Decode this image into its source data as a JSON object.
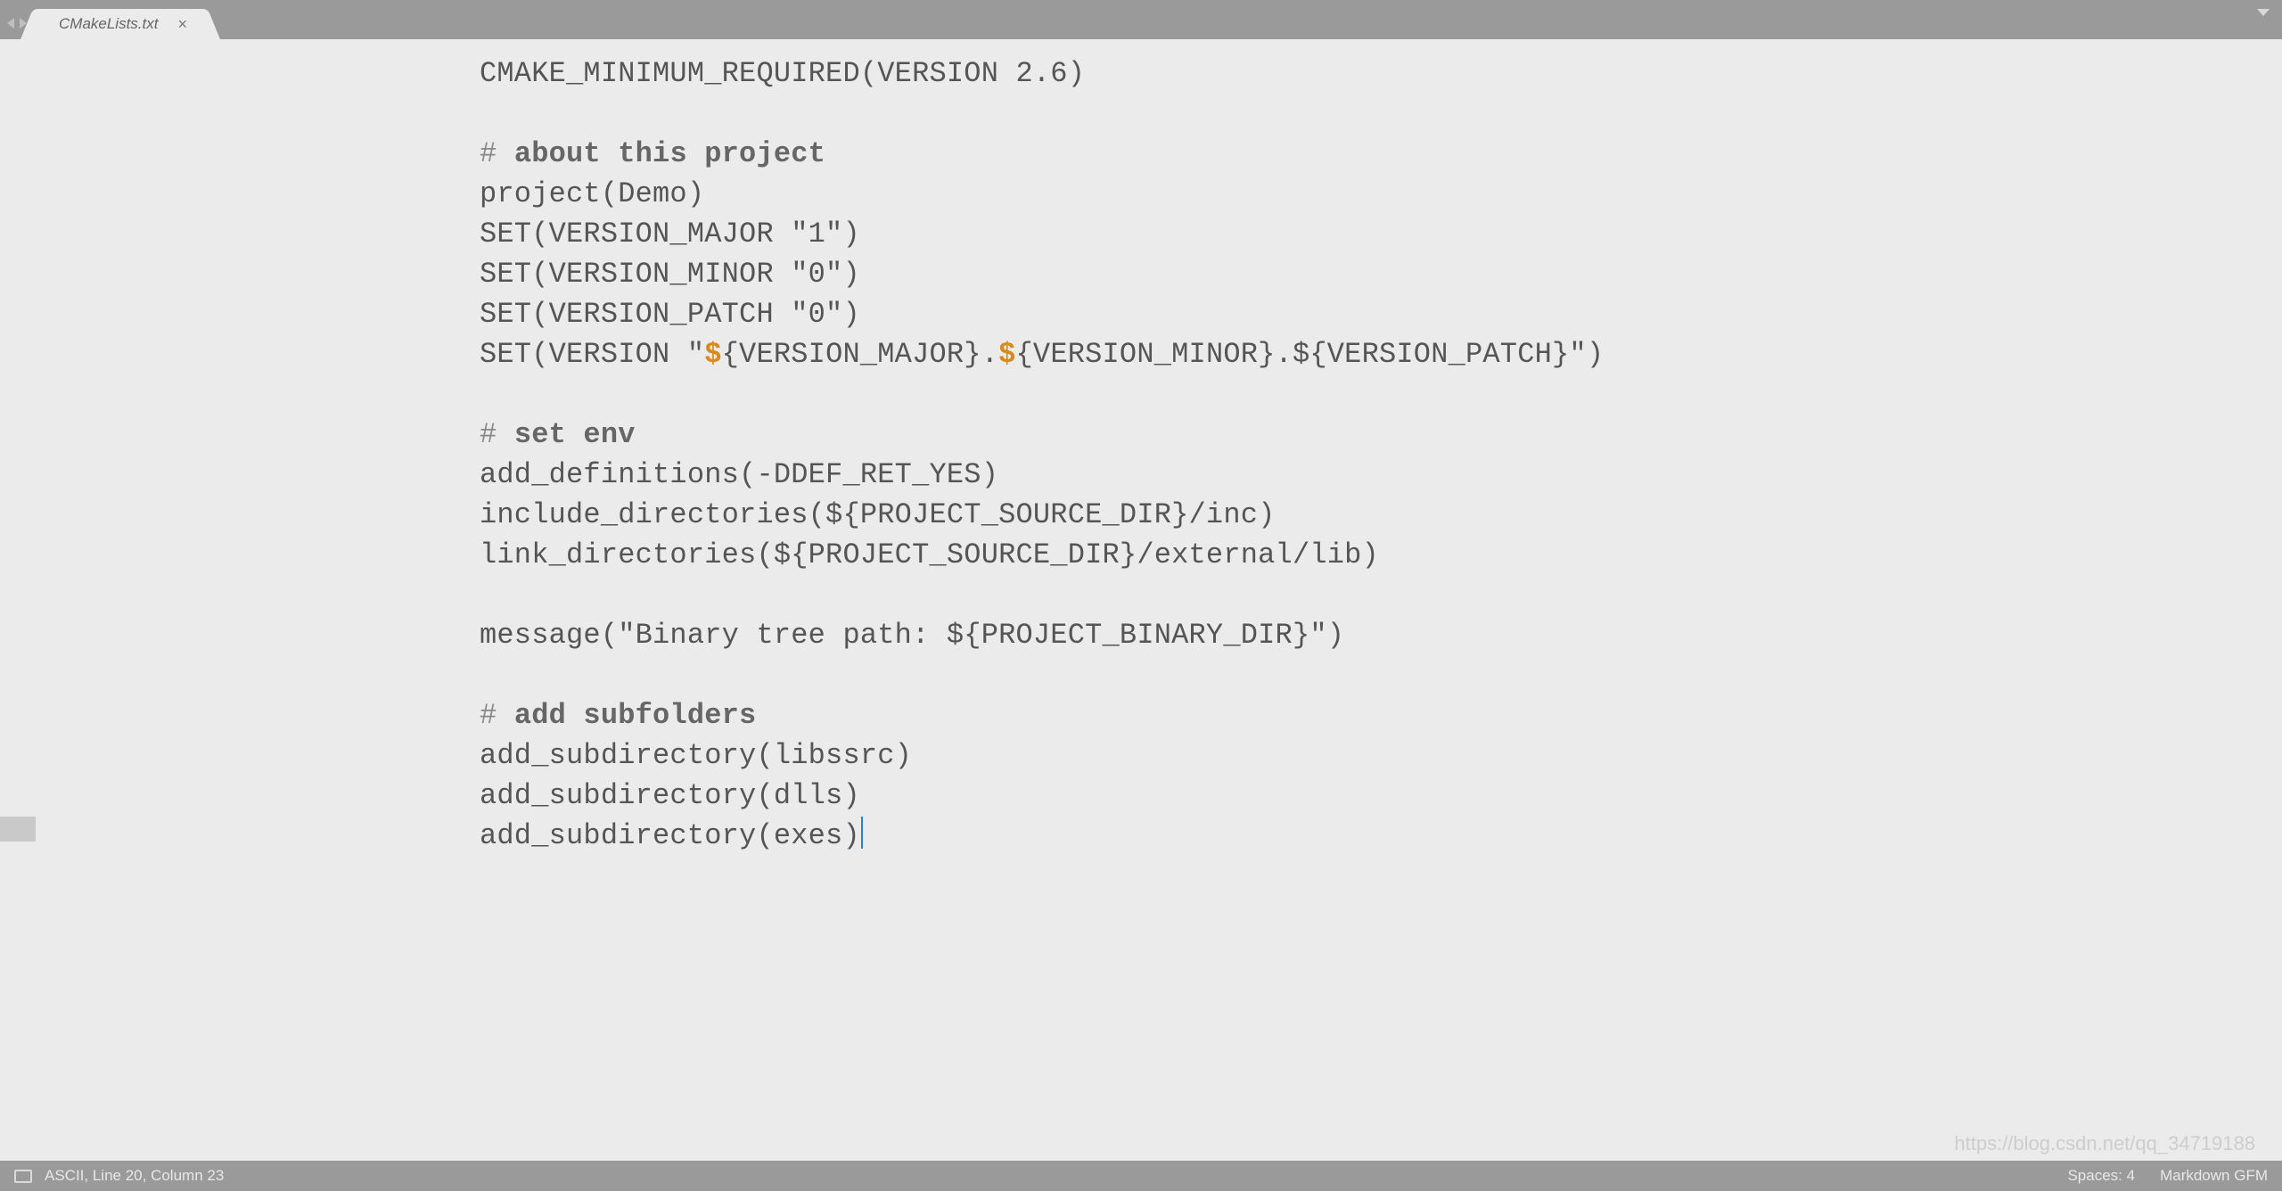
{
  "tab": {
    "title": "CMakeLists.txt",
    "close": "×"
  },
  "code": {
    "l1a": "CMAKE_MINIMUM_REQUIRED(VERSION 2.6)",
    "c1hash": "# ",
    "c1": "about this project",
    "l2": "project(Demo)",
    "l3": "SET(VERSION_MAJOR \"1\")",
    "l4": "SET(VERSION_MINOR \"0\")",
    "l5": "SET(VERSION_PATCH \"0\")",
    "l6a": "SET(VERSION \"",
    "l6b": "{VERSION_MAJOR}.",
    "l6c": "{VERSION_MINOR}.${VERSION_PATCH}\")",
    "c2hash": "# ",
    "c2": "set env",
    "l7": "add_definitions(-DDEF_RET_YES)",
    "l8": "include_directories(${PROJECT_SOURCE_DIR}/inc)",
    "l9": "link_directories(${PROJECT_SOURCE_DIR}/external/lib)",
    "l10": "message(\"Binary tree path: ${PROJECT_BINARY_DIR}\")",
    "c3hash": "# ",
    "c3": "add subfolders",
    "l11": "add_subdirectory(libssrc)",
    "l12": "add_subdirectory(dlls)",
    "l13": "add_subdirectory(exes)",
    "dollar": "$"
  },
  "status": {
    "left": "ASCII, Line 20, Column 23",
    "right1": "Spaces: 4",
    "right2": "Markdown GFM"
  },
  "watermark": "https://blog.csdn.net/qq_34719188"
}
